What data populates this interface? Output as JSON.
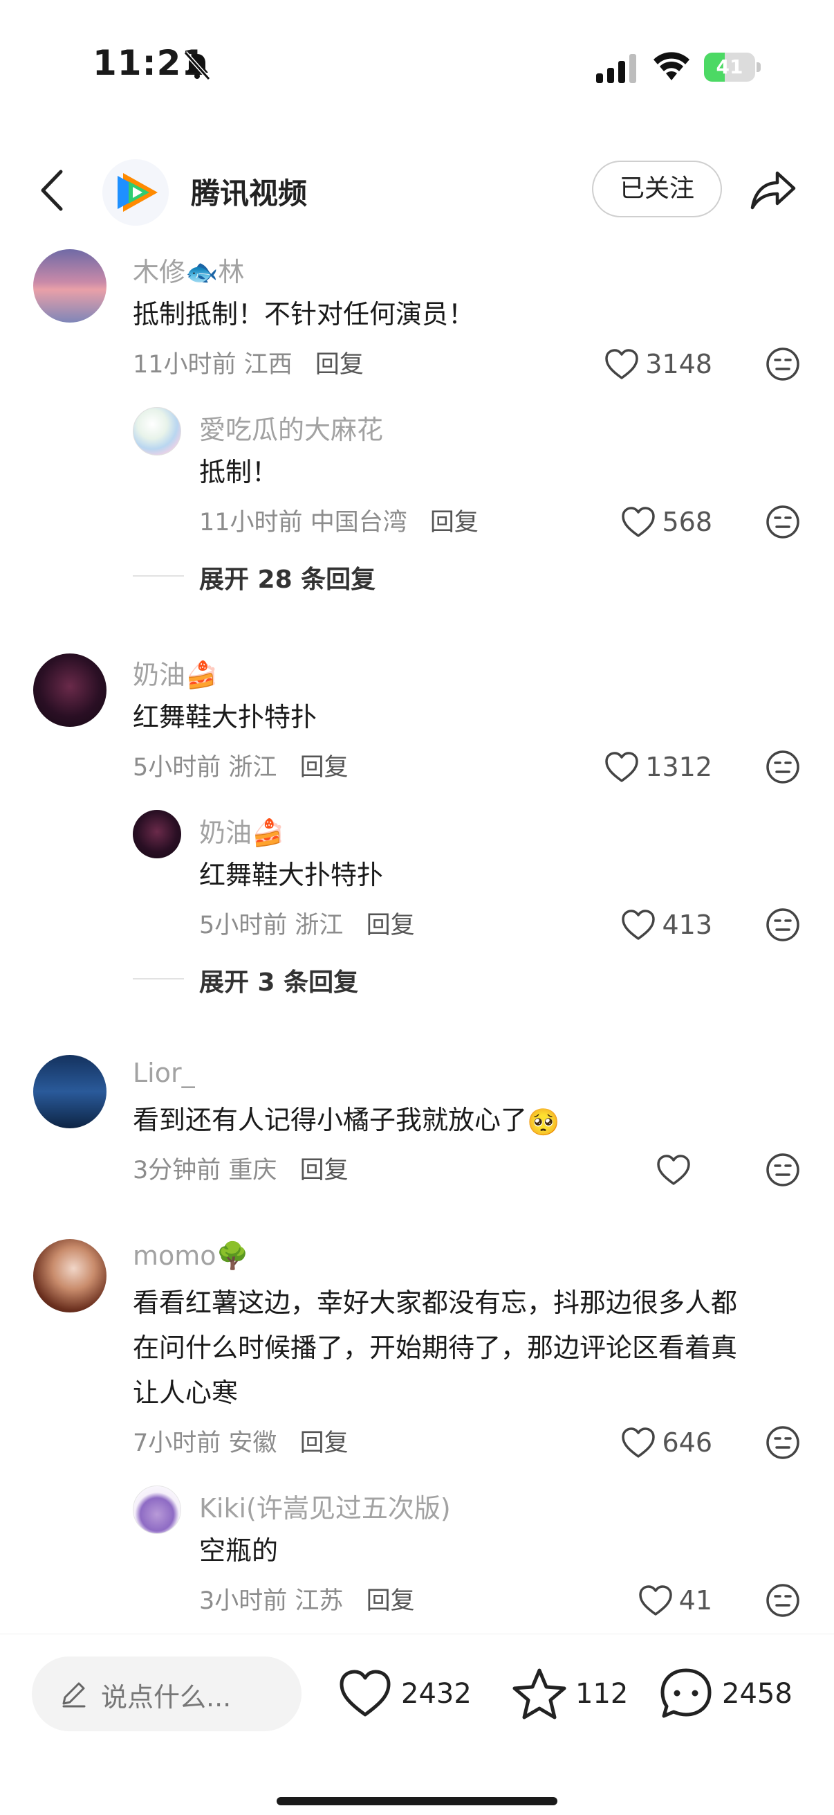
{
  "status_bar": {
    "time": "11:21",
    "battery": "41",
    "battery_level": 0.41
  },
  "header": {
    "app_name": "腾讯视频",
    "follow_label": "已关注"
  },
  "comments": [
    {
      "username": "木修🐟林",
      "text": "抵制抵制！不针对任何演员！",
      "time": "11小时前",
      "location": "江西",
      "reply_label": "回复",
      "likes": "3148",
      "reply": {
        "username": "愛吃瓜的大麻花",
        "text": "抵制！",
        "time": "11小时前",
        "location": "中国台湾",
        "reply_label": "回复",
        "likes": "568"
      },
      "expand_label": "展开 28 条回复"
    },
    {
      "username": "奶油🍰",
      "text": "红舞鞋大扑特扑",
      "time": "5小时前",
      "location": "浙江",
      "reply_label": "回复",
      "likes": "1312",
      "reply": {
        "username": "奶油🍰",
        "text": "红舞鞋大扑特扑",
        "time": "5小时前",
        "location": "浙江",
        "reply_label": "回复",
        "likes": "413"
      },
      "expand_label": "展开 3 条回复"
    },
    {
      "username": "Lior_",
      "text": "看到还有人记得小橘子我就放心了",
      "emoji": "🥺",
      "time": "3分钟前",
      "location": "重庆",
      "reply_label": "回复",
      "likes": ""
    },
    {
      "username": "momo🌳",
      "text_lines": [
        "看看红薯这边，幸好大家都没有忘，抖那边很多人都",
        "在问什么时候播了，开始期待了，那边评论区看着真",
        "让人心寒"
      ],
      "time": "7小时前",
      "location": "安徽",
      "reply_label": "回复",
      "likes": "646",
      "reply": {
        "username": "Kiki(许嵩见过五次版)",
        "text": "空瓶的",
        "time": "3小时前",
        "location": "江苏",
        "reply_label": "回复",
        "likes": "41"
      }
    }
  ],
  "bottom_bar": {
    "input_placeholder": "说点什么...",
    "likes": "2432",
    "favorites": "112",
    "comments": "2458"
  },
  "icons": [
    "bell-slash-icon",
    "signal-icon",
    "wifi-icon",
    "back-chevron-icon",
    "share-arrow-icon",
    "heart-icon",
    "meh-face-icon",
    "pencil-icon",
    "star-icon",
    "chat-bubble-icon"
  ],
  "colors": {
    "accent_green": "#4cd964",
    "muted_text": "#a2a2a2",
    "meta_text": "#8c8c8c"
  }
}
